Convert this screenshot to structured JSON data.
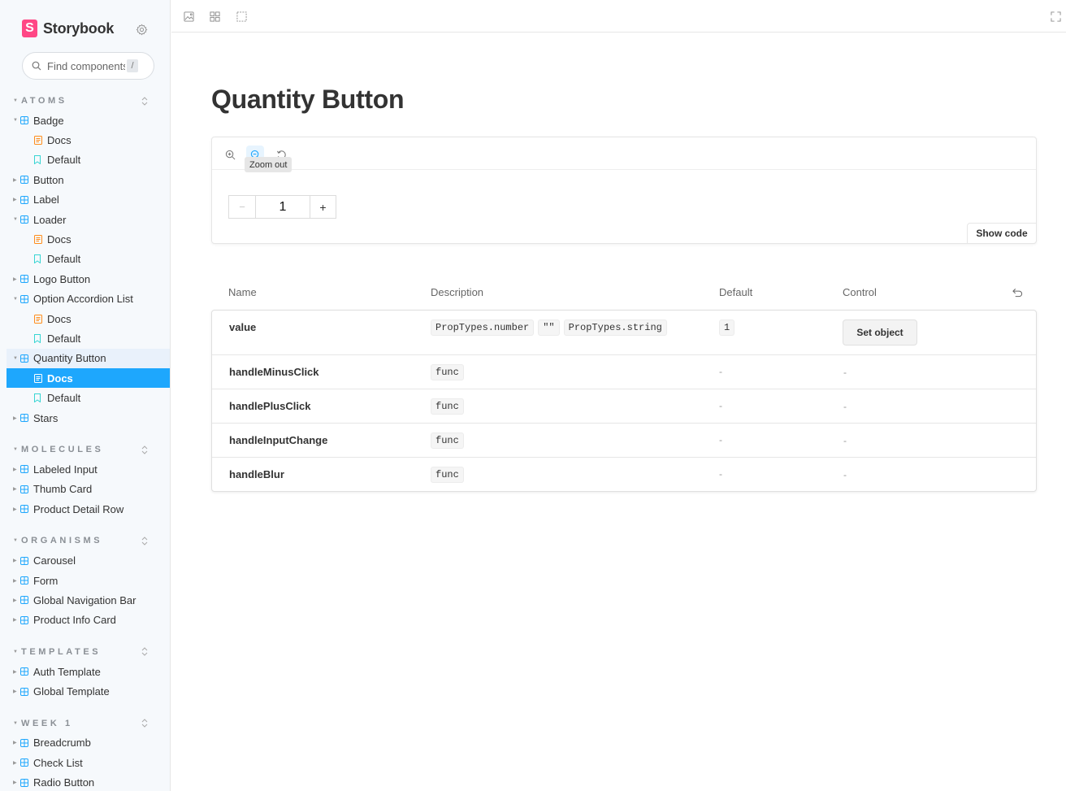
{
  "brand": {
    "name": "Storybook",
    "logo_letter": "S",
    "color": "#ff4785"
  },
  "search": {
    "placeholder": "Find components",
    "shortcut": "/"
  },
  "sidebar": {
    "groups": [
      {
        "label": "ATOMS",
        "items": [
          {
            "label": "Badge",
            "children": [
              "Docs",
              "Default"
            ]
          },
          {
            "label": "Button"
          },
          {
            "label": "Label"
          },
          {
            "label": "Loader",
            "children": [
              "Docs",
              "Default"
            ]
          },
          {
            "label": "Logo Button"
          },
          {
            "label": "Option Accordion List",
            "children": [
              "Docs",
              "Default"
            ]
          },
          {
            "label": "Quantity Button",
            "children": [
              "Docs",
              "Default"
            ]
          },
          {
            "label": "Stars"
          }
        ]
      },
      {
        "label": "MOLECULES",
        "items": [
          {
            "label": "Labeled Input"
          },
          {
            "label": "Thumb Card"
          },
          {
            "label": "Product Detail Row"
          }
        ]
      },
      {
        "label": "ORGANISMS",
        "items": [
          {
            "label": "Carousel"
          },
          {
            "label": "Form"
          },
          {
            "label": "Global Navigation Bar"
          },
          {
            "label": "Product Info Card"
          }
        ]
      },
      {
        "label": "TEMPLATES",
        "items": [
          {
            "label": "Auth Template"
          },
          {
            "label": "Global Template"
          }
        ]
      },
      {
        "label": "WEEK 1",
        "items": [
          {
            "label": "Breadcrumb"
          },
          {
            "label": "Check List"
          },
          {
            "label": "Radio Button"
          }
        ]
      }
    ]
  },
  "page": {
    "title": "Quantity Button"
  },
  "preview": {
    "tooltip": "Zoom out",
    "quantity": {
      "minus": "−",
      "value": "1",
      "plus": "+"
    },
    "show_code": "Show code"
  },
  "args_table": {
    "headers": {
      "name": "Name",
      "description": "Description",
      "default": "Default",
      "control": "Control"
    },
    "rows": [
      {
        "name": "value",
        "types": [
          "PropTypes.number",
          "\"\"",
          "PropTypes.string"
        ],
        "default": "1",
        "control": "Set object"
      },
      {
        "name": "handleMinusClick",
        "types": [
          "func"
        ],
        "default": "-",
        "control": "-"
      },
      {
        "name": "handlePlusClick",
        "types": [
          "func"
        ],
        "default": "-",
        "control": "-"
      },
      {
        "name": "handleInputChange",
        "types": [
          "func"
        ],
        "default": "-",
        "control": "-"
      },
      {
        "name": "handleBlur",
        "types": [
          "func"
        ],
        "default": "-",
        "control": "-"
      }
    ]
  },
  "colors": {
    "selected": "#1ea7fd",
    "component_icon": "#1ea7fd",
    "doc_icon": "#ff8c1a",
    "story_icon": "#37d5d3"
  },
  "icons": {
    "settings": "gear-icon",
    "search": "search-icon",
    "toolbar": [
      "image-icon",
      "grid-icon",
      "outline-icon"
    ],
    "fullscreen": "fullscreen-icon",
    "zoom": [
      "zoom-in-icon",
      "zoom-out-icon",
      "zoom-reset-icon"
    ],
    "reset": "undo-icon"
  }
}
